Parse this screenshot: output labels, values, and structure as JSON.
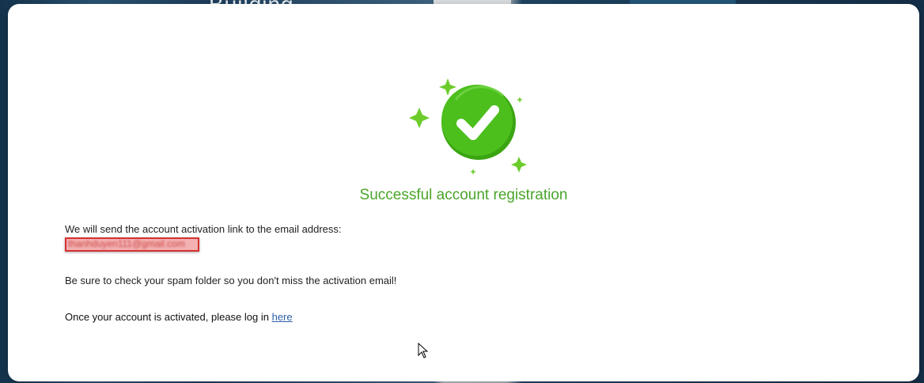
{
  "background": {
    "heading": "Building"
  },
  "modal": {
    "title": "Successful account registration",
    "message_line_1": "We will send the account activation link to the email address:",
    "email": "thanhduyen111@gmail.com",
    "message_line_2": "Be sure to check your spam folder so you don't miss the activation email!",
    "login_prompt": "Once your account is activated, please log in ",
    "login_link": "here"
  },
  "colors": {
    "success_green": "#4aa52a",
    "check_circle": "#44b51c",
    "sparkle": "#6dcc2c",
    "link_blue": "#2b5fa8",
    "redaction_red": "#d63232"
  },
  "icons": {
    "success": "check-circle-icon",
    "sparkles": "sparkle-icon",
    "pointer": "mouse-cursor-icon"
  }
}
